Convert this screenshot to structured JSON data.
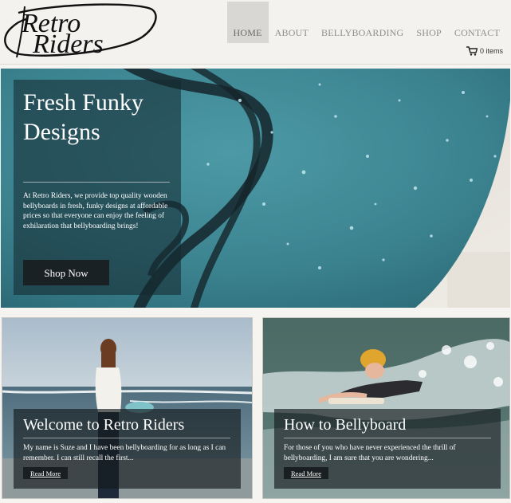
{
  "brand": {
    "logo_text": "Retro Riders"
  },
  "nav": {
    "items": [
      {
        "label": "HOME",
        "active": true
      },
      {
        "label": "ABOUT",
        "active": false
      },
      {
        "label": "BELLYBOARDING",
        "active": false
      },
      {
        "label": "SHOP",
        "active": false
      },
      {
        "label": "CONTACT",
        "active": false
      }
    ]
  },
  "cart": {
    "label": "0 items",
    "icon": "cart-icon"
  },
  "hero": {
    "title": "Fresh Funky Designs",
    "text": "At Retro Riders, we provide top quality wooden bellyboards in fresh, funky designs at affordable prices so that everyone can enjoy the feeling of exhilaration that bellyboarding brings!",
    "button_label": "Shop Now"
  },
  "cards": [
    {
      "title": "Welcome to Retro Riders",
      "text": "My name is Suze and I have been bellyboarding for as long as I can remember.  I can still recall the first...",
      "button_label": "Read More"
    },
    {
      "title": "How to Bellyboard",
      "text": "For those of you who have never experienced the thrill of bellyboarding, I am sure that you are wondering...",
      "button_label": "Read More"
    }
  ],
  "colors": {
    "accent_teal": "#3f8f9d",
    "panel_dark": "#1a2124",
    "nav_text": "#8f8f8f"
  }
}
